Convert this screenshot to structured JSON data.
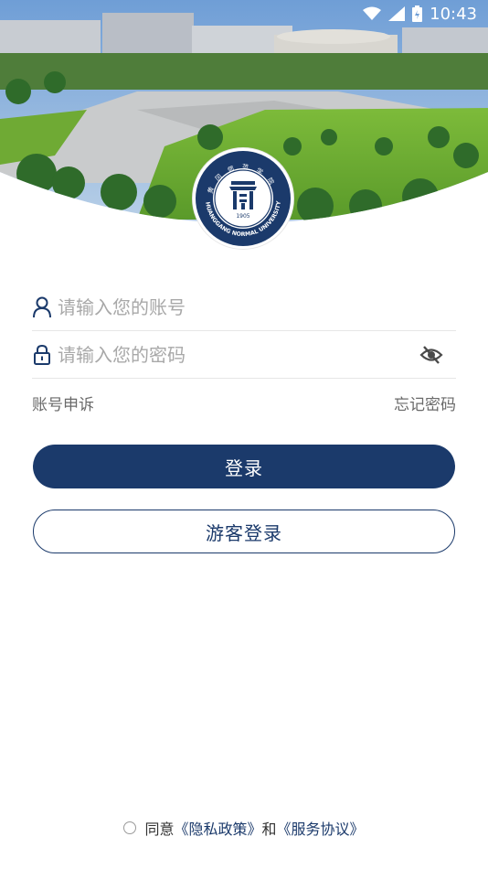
{
  "status_bar": {
    "time": "10:43"
  },
  "logo": {
    "name_en": "HUANGGANG NORMAL UNIVERSITY",
    "year": "1905"
  },
  "login": {
    "account_placeholder": "请输入您的账号",
    "password_placeholder": "请输入您的密码",
    "account_appeal": "账号申诉",
    "forgot_password": "忘记密码",
    "login_button": "登录",
    "guest_login_button": "游客登录"
  },
  "agreement": {
    "agree_text": "同意",
    "privacy_policy": "《隐私政策》",
    "and_text": "和",
    "service_agreement": "《服务协议》"
  },
  "colors": {
    "primary": "#1b3a6b",
    "placeholder": "#a8a8a8"
  },
  "icons": [
    "wifi-icon",
    "signal-icon",
    "battery-icon",
    "user-icon",
    "lock-icon",
    "eye-off-icon"
  ]
}
